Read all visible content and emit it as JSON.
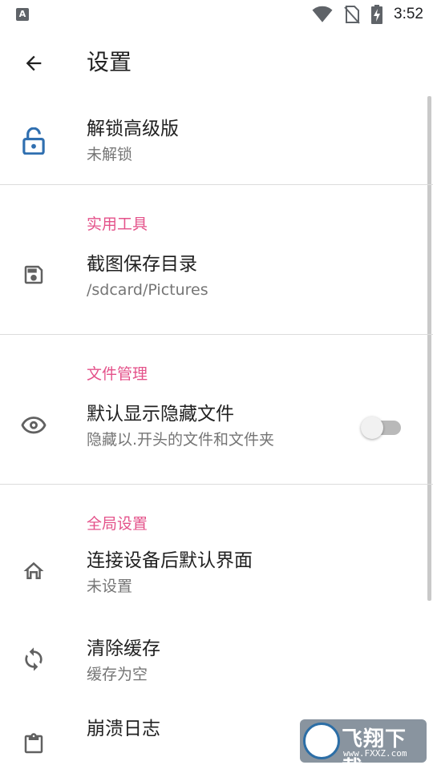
{
  "status_bar": {
    "left_icon": "A",
    "time": "3:52",
    "icons": [
      "wifi-icon",
      "no-sim-icon",
      "battery-charging-icon"
    ]
  },
  "app_bar": {
    "title": "设置",
    "back_icon": "arrow-back-icon"
  },
  "unlock": {
    "title": "解锁高级版",
    "summary": "未解锁",
    "icon": "lock-open-icon",
    "icon_color": "#2f6fb0"
  },
  "categories": {
    "tools": "实用工具",
    "file_management": "文件管理",
    "global": "全局设置"
  },
  "items": {
    "screenshot_dir": {
      "title": "截图保存目录",
      "summary": "/sdcard/Pictures",
      "icon": "save-icon"
    },
    "show_hidden": {
      "title": "默认显示隐藏文件",
      "summary": "隐藏以.开头的文件和文件夹",
      "icon": "eye-icon",
      "toggle_on": false
    },
    "default_view": {
      "title": "连接设备后默认界面",
      "summary": "未设置",
      "icon": "home-icon"
    },
    "clear_cache": {
      "title": "清除缓存",
      "summary": "缓存为空",
      "icon": "sync-icon"
    },
    "crash_log": {
      "title": "崩溃日志",
      "summary": "",
      "icon": "clipboard-icon"
    }
  },
  "watermark": {
    "text": "飞翔下载",
    "url": "www.FXXZ.com"
  },
  "colors": {
    "accent": "#e4528a",
    "text_primary": "#212121",
    "text_secondary": "#757575",
    "icon_gray": "#616161"
  }
}
